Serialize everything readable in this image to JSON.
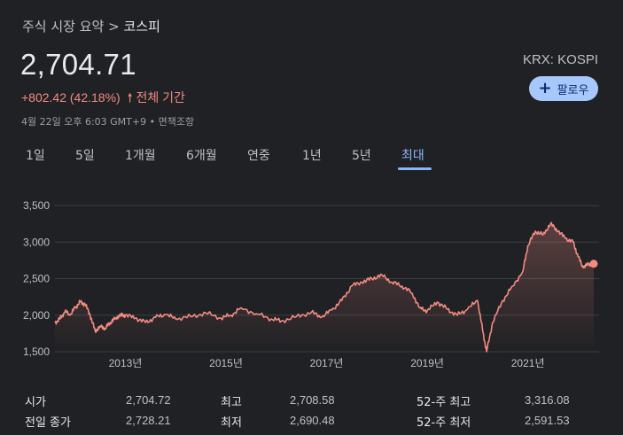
{
  "breadcrumb": {
    "parent": "주식 시장 요약",
    "separator": ">",
    "current": "코스피"
  },
  "quote": {
    "price": "2,704.71",
    "exchange": "KRX: KOSPI",
    "change": "+802.42 (42.18%)",
    "change_arrow": "🠕",
    "change_period": "전체 기간",
    "timestamp": "4월 22일 오후 6:03 GMT+9 • 면책조항"
  },
  "follow_button": {
    "icon": "plus-icon",
    "label": "팔로우"
  },
  "tabs": [
    {
      "label": "1일"
    },
    {
      "label": "5일"
    },
    {
      "label": "1개월"
    },
    {
      "label": "6개월"
    },
    {
      "label": "연중"
    },
    {
      "label": "1년"
    },
    {
      "label": "5년"
    },
    {
      "label": "최대",
      "active": true
    }
  ],
  "colors": {
    "line": "#f28b82",
    "accent": "#8ab4f8",
    "background": "#202124",
    "button": "#a8c7fa"
  },
  "chart_data": {
    "type": "line",
    "y_ticks": [
      "3,500",
      "3,000",
      "2,500",
      "2,000",
      "1,500"
    ],
    "y_tick_values": [
      3500,
      3000,
      2500,
      2000,
      1500
    ],
    "ylim": [
      1500,
      3500
    ],
    "x_ticks": [
      "2013년",
      "2015년",
      "2017년",
      "2019년",
      "2021년"
    ],
    "x_tick_values": [
      2013,
      2015,
      2017,
      2019,
      2021
    ],
    "xlim": [
      2011.6,
      2022.31
    ],
    "grid": true,
    "series": [
      {
        "x": [
          2011.6,
          2011.7,
          2011.8,
          2011.9,
          2012.0,
          2012.1,
          2012.2,
          2012.3,
          2012.4,
          2012.5,
          2012.6,
          2012.7,
          2012.8,
          2012.9,
          2013.0,
          2013.2,
          2013.4,
          2013.6,
          2013.8,
          2014.0,
          2014.3,
          2014.6,
          2014.9,
          2015.1,
          2015.3,
          2015.6,
          2015.9,
          2016.1,
          2016.4,
          2016.7,
          2016.9,
          2017.1,
          2017.3,
          2017.5,
          2017.7,
          2017.9,
          2018.1,
          2018.3,
          2018.5,
          2018.7,
          2018.85,
          2019.0,
          2019.2,
          2019.4,
          2019.6,
          2019.8,
          2020.0,
          2020.1,
          2020.18,
          2020.3,
          2020.5,
          2020.7,
          2020.9,
          2021.0,
          2021.15,
          2021.3,
          2021.45,
          2021.6,
          2021.75,
          2021.9,
          2022.0,
          2022.1,
          2022.2,
          2022.31
        ],
        "y": [
          1900,
          1950,
          2050,
          2000,
          2100,
          2180,
          2150,
          2000,
          1780,
          1850,
          1820,
          1900,
          1960,
          2000,
          2000,
          1960,
          1900,
          1970,
          2010,
          1950,
          1980,
          2030,
          1960,
          2000,
          2100,
          2020,
          1950,
          1920,
          1980,
          2040,
          1970,
          2070,
          2200,
          2400,
          2450,
          2500,
          2550,
          2450,
          2400,
          2300,
          2100,
          2060,
          2180,
          2080,
          2000,
          2080,
          2200,
          1800,
          1500,
          1900,
          2200,
          2400,
          2600,
          2950,
          3150,
          3100,
          3250,
          3150,
          3050,
          3000,
          2800,
          2650,
          2700,
          2704
        ]
      }
    ]
  },
  "stats": {
    "open_label": "시가",
    "open_value": "2,704.72",
    "high_label": "최고",
    "high_value": "2,708.58",
    "week52_high_label": "52-주 최고",
    "week52_high_value": "3,316.08",
    "prev_close_label": "전일 종가",
    "prev_close_value": "2,728.21",
    "low_label": "최저",
    "low_value": "2,690.48",
    "week52_low_label": "52-주 최저",
    "week52_low_value": "2,591.53"
  }
}
